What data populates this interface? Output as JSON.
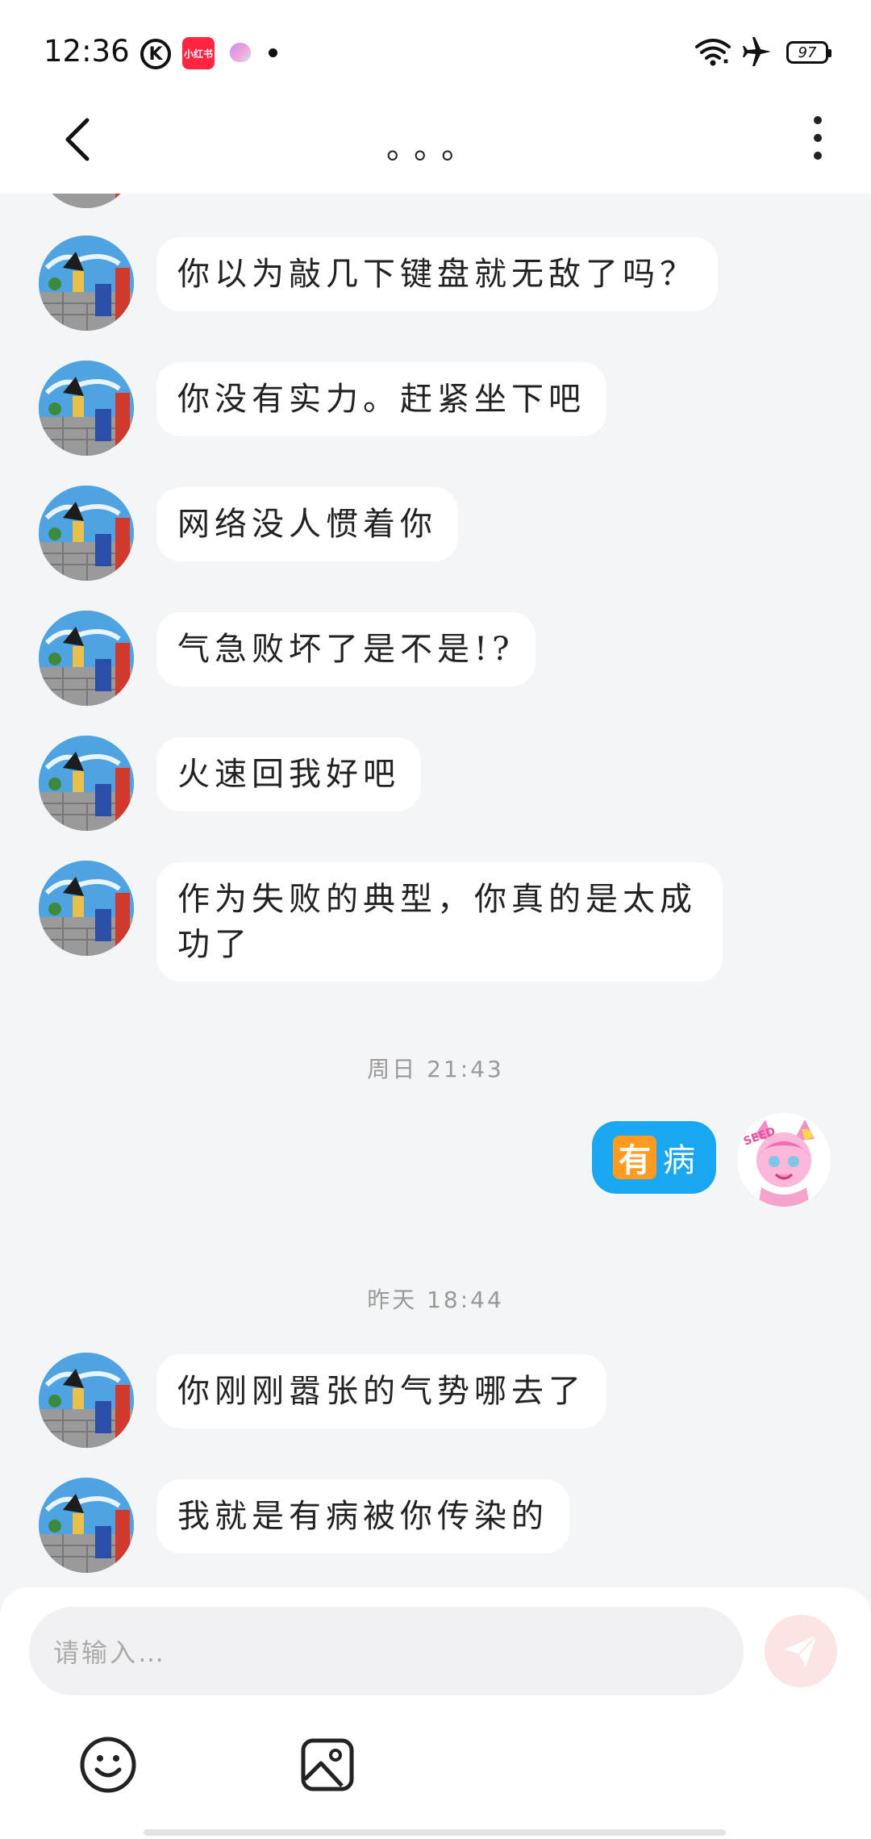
{
  "status_bar": {
    "time": "12:36",
    "app_icons": [
      "k-circle-icon",
      "xiaohongshu-icon",
      "app-icon",
      "notification-dot-icon"
    ],
    "k_label": "K",
    "xhs_label": "小红书",
    "battery": "97"
  },
  "header": {
    "title": "。。。",
    "back_icon": "chevron-left-icon",
    "more_icon": "more-vertical-icon"
  },
  "messages": [
    {
      "from": "other",
      "text": "你以为敲几下键盘就无敌了吗？"
    },
    {
      "from": "other",
      "text": "你没有实力。赶紧坐下吧"
    },
    {
      "from": "other",
      "text": "网络没人惯着你"
    },
    {
      "from": "other",
      "text": "气急败坏了是不是!?"
    },
    {
      "from": "other",
      "text": "火速回我好吧"
    },
    {
      "from": "other",
      "text": "作为失败的典型，你真的是太成功了"
    },
    {
      "type": "time",
      "text": "周日 21:43"
    },
    {
      "from": "self",
      "emoji": "有",
      "text": "病"
    },
    {
      "type": "time",
      "text": "昨天 18:44"
    },
    {
      "from": "other",
      "text": "你刚刚嚣张的气势哪去了"
    },
    {
      "from": "other",
      "text": "我就是有病被你传染的"
    }
  ],
  "input": {
    "placeholder": "请输入…"
  },
  "toolbar": {
    "emoji_icon": "smiley-icon",
    "image_icon": "image-icon",
    "send_icon": "send-icon"
  },
  "colors": {
    "self_bubble": "#1aa7f2",
    "send_button_bg": "#fde4e4",
    "background": "#f4f5f7"
  }
}
